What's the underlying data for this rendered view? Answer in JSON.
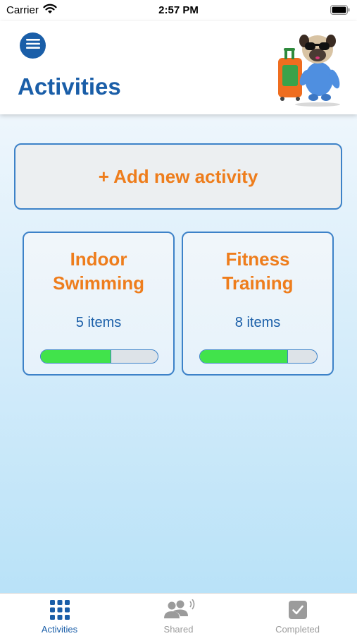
{
  "status_bar": {
    "carrier": "Carrier",
    "time": "2:57 PM"
  },
  "header": {
    "title": "Activities",
    "menu_icon": "menu-icon",
    "mascot": "pug-traveler-mascot"
  },
  "add_activity": {
    "label": "+ Add new activity"
  },
  "activities": [
    {
      "title_line1": "Indoor",
      "title_line2": "Swimming",
      "count": "5 items",
      "progress": 0.6
    },
    {
      "title_line1": "Fitness",
      "title_line2": "Training",
      "count": "8 items",
      "progress": 0.75
    }
  ],
  "tabs": [
    {
      "label": "Activities",
      "icon": "grid-icon",
      "active": true
    },
    {
      "label": "Shared",
      "icon": "people-icon",
      "active": false
    },
    {
      "label": "Completed",
      "icon": "checkbox-icon",
      "active": false
    }
  ],
  "colors": {
    "primary": "#1a5ea8",
    "accent": "#ee7d1c",
    "progress": "#41e34b",
    "inactive": "#9b9b9b"
  }
}
